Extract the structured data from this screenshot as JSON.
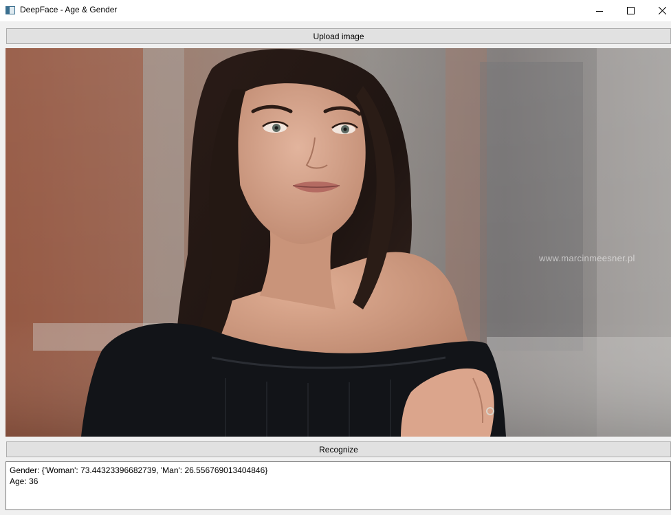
{
  "window": {
    "title": "DeepFace - Age & Gender"
  },
  "controls": {
    "upload_label": "Upload image",
    "recognize_label": "Recognize"
  },
  "image": {
    "watermark": "www.marcinmeesner.pl"
  },
  "result": {
    "gender_line": "Gender: {'Woman': 73.44323396682739, 'Man': 26.556769013404846}",
    "age_line": "Age: 36"
  }
}
